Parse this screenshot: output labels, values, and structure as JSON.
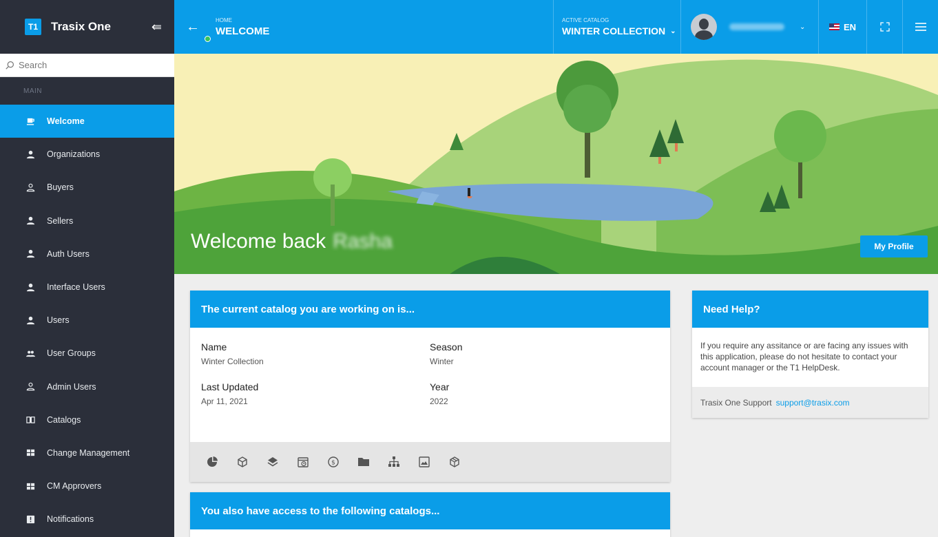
{
  "app": {
    "badge": "T1",
    "name": "Trasix One"
  },
  "search": {
    "placeholder": "Search"
  },
  "sidebar": {
    "section_label": "MAIN",
    "items": [
      {
        "label": "Welcome",
        "icon": "coffee-icon",
        "active": true
      },
      {
        "label": "Organizations",
        "icon": "user-icon"
      },
      {
        "label": "Buyers",
        "icon": "user-outline-icon"
      },
      {
        "label": "Sellers",
        "icon": "user-icon"
      },
      {
        "label": "Auth Users",
        "icon": "user-icon"
      },
      {
        "label": "Interface Users",
        "icon": "user-icon"
      },
      {
        "label": "Users",
        "icon": "user-icon"
      },
      {
        "label": "User Groups",
        "icon": "users-icon"
      },
      {
        "label": "Admin Users",
        "icon": "user-outline-icon"
      },
      {
        "label": "Catalogs",
        "icon": "book-icon"
      },
      {
        "label": "Change Management",
        "icon": "grid-icon"
      },
      {
        "label": "CM Approvers",
        "icon": "grid-icon"
      },
      {
        "label": "Notifications",
        "icon": "alert-icon"
      }
    ]
  },
  "header": {
    "crumb_small": "HOME",
    "crumb_big": "WELCOME",
    "catalog_small": "ACTIVE CATALOG",
    "catalog_big": "WINTER COLLECTION",
    "language": "EN"
  },
  "hero": {
    "welcome": "Welcome back",
    "name": "Rasha",
    "profile_button": "My Profile"
  },
  "catalog_card": {
    "title": "The current catalog you are working on is...",
    "fields": {
      "name_label": "Name",
      "name_value": "Winter Collection",
      "season_label": "Season",
      "season_value": "Winter",
      "updated_label": "Last Updated",
      "updated_value": "Apr 11, 2021",
      "year_label": "Year",
      "year_value": "2022"
    },
    "tools": [
      "pie-chart-icon",
      "cube-icon",
      "layers-icon",
      "calendar-clock-icon",
      "dollar-icon",
      "folder-icon",
      "sitemap-icon",
      "image-icon",
      "box-icon"
    ]
  },
  "access_card": {
    "title": "You also have access to the following catalogs..."
  },
  "help_card": {
    "title": "Need Help?",
    "body": "If you require any assitance or are facing any issues with this application, please do not hesitate to contact your account manager or the T1 HelpDesk.",
    "footer_label": "Trasix One Support",
    "footer_link": "support@trasix.com"
  },
  "colors": {
    "accent": "#0a9de8",
    "sidebar": "#2b2f3a",
    "background": "#eeeeee"
  }
}
